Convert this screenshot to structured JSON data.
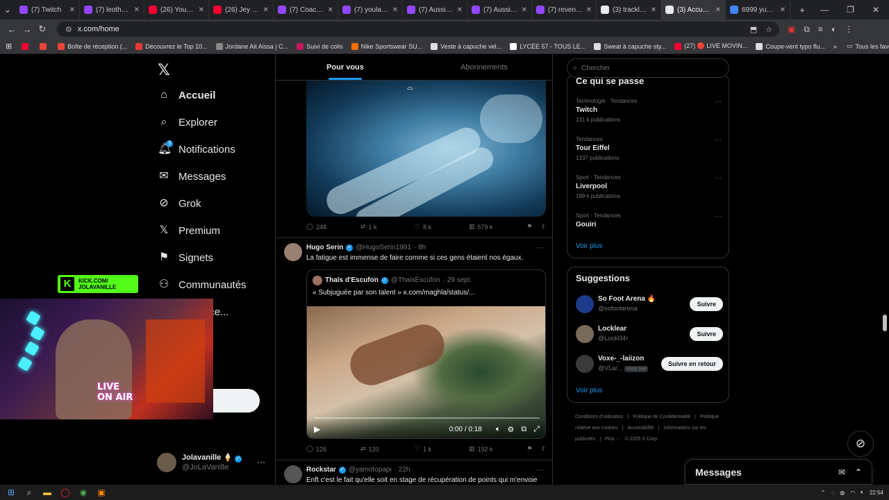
{
  "browser": {
    "tabs": [
      {
        "label": "(7) Twitch",
        "color": "#9146ff",
        "active": false
      },
      {
        "label": "(7) leothecra...",
        "color": "#9146ff",
        "active": false
      },
      {
        "label": "(26) YouTube",
        "color": "#ff0033",
        "active": false
      },
      {
        "label": "(26) Jey Brow...",
        "color": "#ff0033",
        "active": false
      },
      {
        "label": "(7) CoachBo...",
        "color": "#9146ff",
        "active": false
      },
      {
        "label": "(7) youladec...",
        "color": "#9146ff",
        "active": false
      },
      {
        "label": "(7) AussieAn...",
        "color": "#9146ff",
        "active": false
      },
      {
        "label": "(7) AussieAn...",
        "color": "#9146ff",
        "active": false
      },
      {
        "label": "(7) revenja_...",
        "color": "#9146ff",
        "active": false
      },
      {
        "label": "(3) tracklist ...",
        "color": "#e7e9ea",
        "active": false
      },
      {
        "label": "(3) Accueil / ...",
        "color": "#e7e9ea",
        "active": true
      },
      {
        "label": "6999 yuan e...",
        "color": "#4285f4",
        "active": false
      }
    ],
    "url": "x.com/home",
    "bookmarks": [
      {
        "label": "",
        "color": "#ff0033"
      },
      {
        "label": "",
        "color": "#ea4335"
      },
      {
        "label": "Boîte de réception (...",
        "color": "#ea4335"
      },
      {
        "label": "Découvrez le Top 10...",
        "color": "#e53935"
      },
      {
        "label": "Jordane Ait Aissa | C...",
        "color": "#888888"
      },
      {
        "label": "Suivi de colis",
        "color": "#c2185b"
      },
      {
        "label": "Nike Sportswear SU...",
        "color": "#ff6d00"
      },
      {
        "label": "Veste à capuche vel...",
        "color": "#dddddd"
      },
      {
        "label": "LYCÉE 57 - TOUS LE...",
        "color": "#ffffff"
      },
      {
        "label": "Sweat à capuche sty...",
        "color": "#dddddd"
      },
      {
        "label": "(27) 🔴 LIVE MOVIN...",
        "color": "#ff0033"
      },
      {
        "label": "Coupe-vent typo flu...",
        "color": "#dddddd"
      }
    ],
    "all_bookmarks": "Tous les favoris"
  },
  "nav": {
    "items": [
      {
        "label": "Accueil",
        "icon": "⌂"
      },
      {
        "label": "Explorer",
        "icon": "⌕"
      },
      {
        "label": "Notifications",
        "icon": "🔔︎",
        "badge": "3"
      },
      {
        "label": "Messages",
        "icon": "✉"
      },
      {
        "label": "Grok",
        "icon": "⊘"
      },
      {
        "label": "Premium",
        "icon": "𝕏"
      },
      {
        "label": "Signets",
        "icon": "⚑"
      },
      {
        "label": "Communautés",
        "icon": "⚇"
      },
      {
        "label": "ations ce...",
        "icon": ""
      }
    ],
    "post_label": "er",
    "profile": {
      "name": "Jolavanille",
      "emoji": "🍦",
      "handle": "@JoLaVanille"
    }
  },
  "overlay": {
    "kick_line1": "KICK.COM/",
    "kick_line2": "JOLAVANILLE",
    "on_air_1": "LIVE",
    "on_air_2": "ON AIR"
  },
  "feed": {
    "tabs": [
      "Pour vous",
      "Abonnements"
    ],
    "post1_actions": {
      "replies": "248",
      "reposts": "1 k",
      "likes": "8 k",
      "views": "579 k"
    },
    "post2": {
      "name": "Hugo Serin",
      "handle": "@HugoSerin1991",
      "time": "· 8h",
      "text": "La fatigue est immense de faire comme si ces gens étaient nos égaux.",
      "quote": {
        "name": "Thaïs d'Escufon",
        "handle": "@ThaisEscufon",
        "time": "· 29 sept.",
        "text": "« Subjuguée par son talent » x.com/maghla/status/..."
      },
      "video_time": "0:00 / 0:18",
      "actions": {
        "replies": "126",
        "reposts": "120",
        "likes": "1 k",
        "views": "192 k"
      }
    },
    "post3": {
      "name": "Rockstar",
      "handle": "@yamotopapi",
      "time": "· 22h",
      "text": "Enft c'est le fait qu'elle soit en stage de récupération de points qui m'envoie"
    }
  },
  "sidebar": {
    "search_placeholder": "Chercher",
    "trends_title": "Ce qui se passe",
    "trends": [
      {
        "category": "Technologie · Tendances",
        "name": "Twitch",
        "count": "131 k publications"
      },
      {
        "category": "Tendances",
        "name": "Tour Eiffel",
        "count": "1337 publications"
      },
      {
        "category": "Sport · Tendances",
        "name": "Liverpool",
        "count": "199 k publications"
      },
      {
        "category": "Sport · Tendances",
        "name": "Gouiri",
        "count": ""
      }
    ],
    "voir_plus": "Voir plus",
    "suggestions_title": "Suggestions",
    "suggestions": [
      {
        "name": "So Foot Arena 🔥",
        "handle": "@sofootarena",
        "button": "Suivre",
        "color": "#1e3a8a",
        "follows": ""
      },
      {
        "name": "Locklear",
        "handle": "@Lockl34r",
        "button": "Suivre",
        "color": "#7a6a5a",
        "follows": ""
      },
      {
        "name": "Voxe-_-laiizon",
        "handle": "@VLai...",
        "button": "Suivre en retour",
        "color": "#3a3a3a",
        "follows": "Vous suit"
      }
    ],
    "footer": [
      "Conditions d'utilisation",
      "|",
      "Politique de Confidentialité",
      "|",
      "Politique relative aux cookies",
      "|",
      "Accessibilité",
      "|",
      "Informations sur les publicités",
      "|",
      "Plus ···",
      "© 2025 X Corp."
    ],
    "messages_label": "Messages"
  },
  "taskbar": {
    "time": "22:54"
  }
}
